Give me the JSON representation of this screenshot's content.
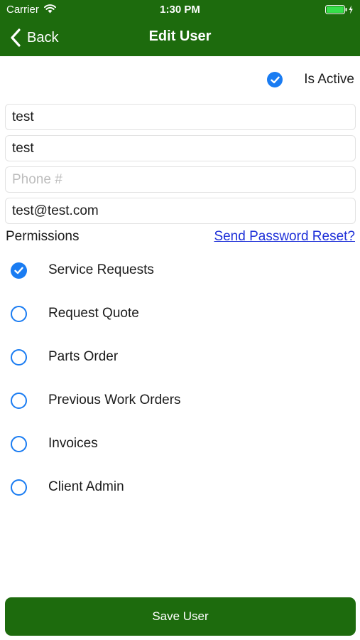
{
  "status_bar": {
    "carrier": "Carrier",
    "time": "1:30 PM"
  },
  "nav": {
    "back_label": "Back",
    "title": "Edit User"
  },
  "active": {
    "label": "Is Active",
    "checked": true
  },
  "fields": {
    "first_name": {
      "value": "test"
    },
    "last_name": {
      "value": "test"
    },
    "phone": {
      "value": "",
      "placeholder": "Phone #"
    },
    "email": {
      "value": "test@test.com"
    }
  },
  "permissions": {
    "heading": "Permissions",
    "reset_link": "Send Password Reset?",
    "items": [
      {
        "label": "Service Requests",
        "checked": true
      },
      {
        "label": "Request Quote",
        "checked": false
      },
      {
        "label": "Parts Order",
        "checked": false
      },
      {
        "label": "Previous Work Orders",
        "checked": false
      },
      {
        "label": "Invoices",
        "checked": false
      },
      {
        "label": "Client Admin",
        "checked": false
      }
    ]
  },
  "save_button": {
    "label": "Save User"
  },
  "colors": {
    "header": "#1d6b0d",
    "accent": "#1a7cf2",
    "link": "#1d2fd8"
  }
}
